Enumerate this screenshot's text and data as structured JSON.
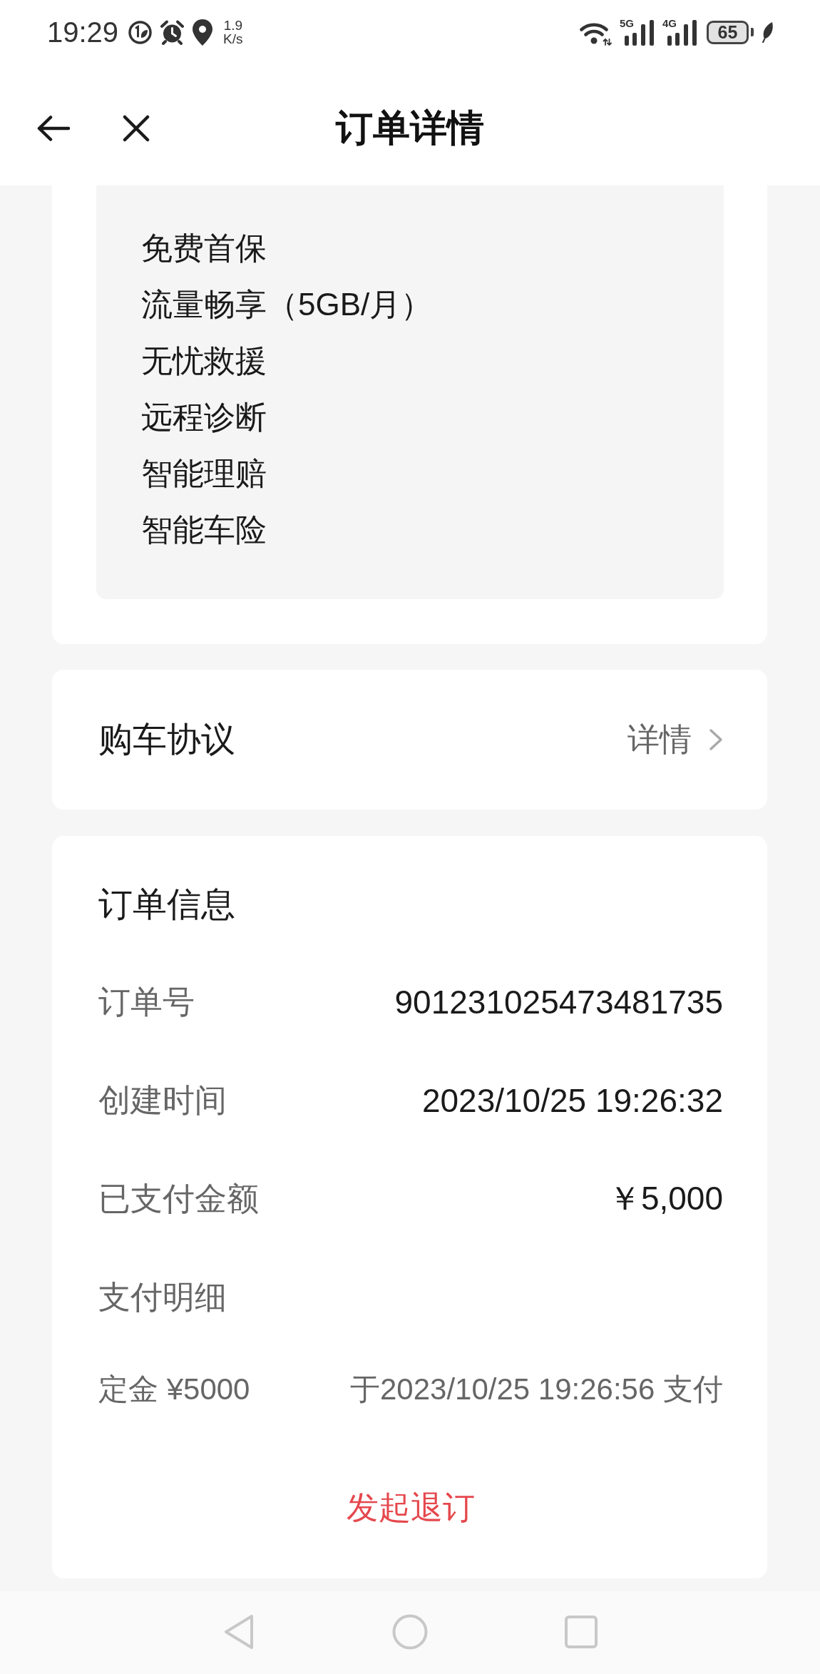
{
  "status_bar": {
    "time": "19:29",
    "net_speed": {
      "value": "1.9",
      "unit": "K/s"
    },
    "signals": [
      {
        "label": "5G"
      },
      {
        "label": "4G"
      }
    ],
    "battery": "65"
  },
  "header": {
    "title": "订单详情"
  },
  "benefits": {
    "items": [
      "免费首保",
      "流量畅享（5GB/月）",
      "无忧救援",
      "远程诊断",
      "智能理赔",
      "智能车险"
    ]
  },
  "agreement": {
    "label": "购车协议",
    "link": "详情"
  },
  "order_info": {
    "title": "订单信息",
    "rows": [
      {
        "label": "订单号",
        "value": "901231025473481735"
      },
      {
        "label": "创建时间",
        "value": "2023/10/25 19:26:32"
      },
      {
        "label": "已支付金额",
        "value": "￥5,000"
      },
      {
        "label": "支付明细"
      }
    ],
    "payments": [
      {
        "label": "定金 ¥5000",
        "value": "于2023/10/25 19:26:56 支付"
      }
    ],
    "cancel_button": "发起退订"
  }
}
